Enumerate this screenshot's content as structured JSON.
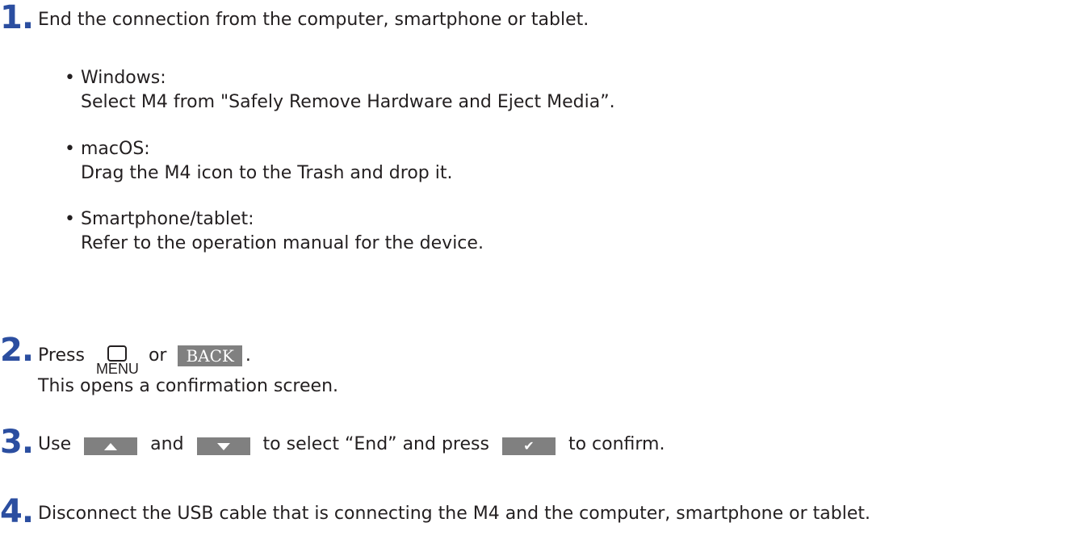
{
  "steps": [
    {
      "number": "1.",
      "text": "End the connection from the computer, smartphone or tablet."
    },
    {
      "number": "2.",
      "text_before": "Press",
      "menu_label": "MENU",
      "text_or": "or",
      "back_label": "BACK",
      "text_after": ".",
      "line2": "This opens a confirmation screen."
    },
    {
      "number": "3.",
      "text_use": "Use",
      "text_and": "and",
      "text_select": "to select “End” and press",
      "text_confirm": "to confirm."
    },
    {
      "number": "4.",
      "text": "Disconnect the USB cable that is connecting the M4 and the computer, smartphone or tablet."
    }
  ],
  "bullets": [
    {
      "title": "Windows:",
      "desc": "Select M4 from \"Safely Remove Hardware and Eject Media”."
    },
    {
      "title": "macOS:",
      "desc": "Drag the M4 icon to the Trash and drop it."
    },
    {
      "title": "Smartphone/tablet:",
      "desc": "Refer to the operation manual for the device."
    }
  ],
  "bullet_char": "•",
  "colors": {
    "step_number": "#2b4ea0",
    "button_bg": "#808080"
  },
  "icons": [
    "menu-button-icon",
    "back-button",
    "up-arrow-icon",
    "down-arrow-icon",
    "checkmark-icon"
  ]
}
